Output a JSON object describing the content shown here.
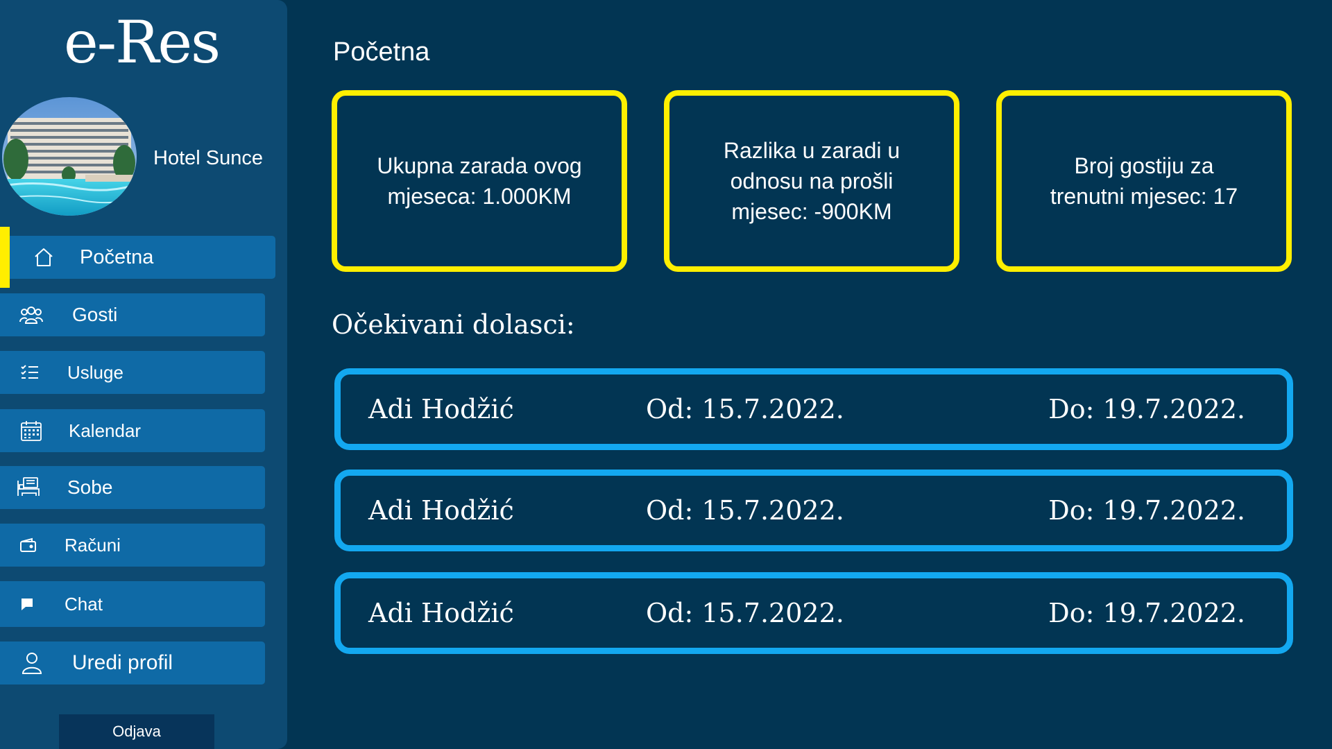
{
  "app": {
    "logo": "e-Res",
    "hotel_name": "Hotel Sunce"
  },
  "sidebar": {
    "items": [
      {
        "label": "Početna",
        "icon": "home-icon",
        "active": true
      },
      {
        "label": "Gosti",
        "icon": "guests-icon"
      },
      {
        "label": "Usluge",
        "icon": "checklist-icon"
      },
      {
        "label": "Kalendar",
        "icon": "calendar-icon"
      },
      {
        "label": "Sobe",
        "icon": "rooms-icon"
      },
      {
        "label": "Računi",
        "icon": "wallet-icon"
      },
      {
        "label": "Chat",
        "icon": "chat-icon"
      },
      {
        "label": "Uredi profil",
        "icon": "user-icon"
      }
    ],
    "logout_label": "Odjava"
  },
  "main": {
    "title": "Početna",
    "stats": [
      {
        "text": "Ukupna zarada ovog mjeseca: 1.000KM"
      },
      {
        "text": "Razlika u zaradi u odnosu na prošli mjesec: -900KM"
      },
      {
        "text": "Broj gostiju za trenutni mjesec: 17"
      }
    ],
    "arrivals_title": "Očekivani dolasci:",
    "arrivals": [
      {
        "guest": "Adi Hodžić",
        "from": "Od: 15.7.2022.",
        "to": "Do: 19.7.2022."
      },
      {
        "guest": "Adi Hodžić",
        "from": "Od: 15.7.2022.",
        "to": "Do: 19.7.2022."
      },
      {
        "guest": "Adi Hodžić",
        "from": "Od: 15.7.2022.",
        "to": "Do: 19.7.2022."
      }
    ]
  },
  "colors": {
    "background": "#023553",
    "sidebar": "#0d4a72",
    "nav_item": "#0f6aa6",
    "stat_border": "#ffef00",
    "arrival_border": "#13a8f0",
    "active_indicator": "#ffee00"
  }
}
